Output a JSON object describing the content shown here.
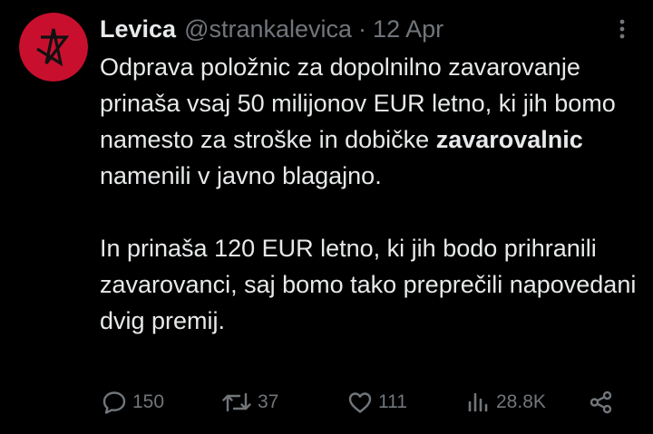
{
  "tweet": {
    "display_name": "Levica",
    "handle": "@strankalevica",
    "separator": "·",
    "date": "12 Apr",
    "paragraph1": {
      "before": "Odprava položnic za dopolnilno zavarovanje prinaša vsaj 50 milijonov EUR letno, ki jih bomo namesto za stroške in dobičke",
      "bold": "zavarovalnic",
      "after": "namenili v javno blagajno."
    },
    "paragraph2": "In prinaša 120 EUR letno, ki jih bodo prihranili zavarovanci, saj bomo tako preprečili napovedani dvig premij."
  },
  "actions": {
    "replies": "150",
    "retweets": "37",
    "likes": "111",
    "views": "28.8K"
  },
  "icons": {
    "avatar": "red-star-logo-icon",
    "more": "more-vertical-icon",
    "reply": "reply-icon",
    "retweet": "retweet-icon",
    "like": "heart-icon",
    "views": "views-bar-chart-icon",
    "share": "share-icon"
  },
  "colors": {
    "background": "#000000",
    "text": "#e7e9ea",
    "muted": "#71767b",
    "avatar_red": "#c8102e"
  }
}
